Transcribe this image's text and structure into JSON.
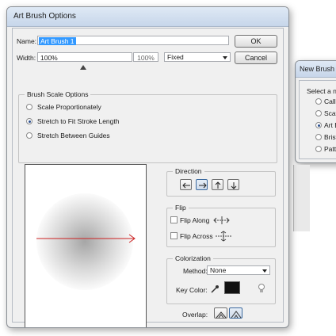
{
  "background_window": {
    "title": "New Brush",
    "prompt": "Select a ne",
    "options": [
      "Callig",
      "Scatt",
      "Art Br",
      "Bristle",
      "Patte"
    ],
    "selected_index": 2
  },
  "dialog": {
    "title": "Art Brush Options",
    "name_label": "Name:",
    "name_value": "Art Brush 1",
    "ok_label": "OK",
    "cancel_label": "Cancel",
    "width_label": "Width:",
    "width_value": "100%",
    "width_readout": "100%",
    "width_mode": "Fixed",
    "scale_options": {
      "legend": "Brush Scale Options",
      "options": [
        "Scale Proportionately",
        "Stretch to Fit Stroke Length",
        "Stretch Between Guides"
      ],
      "selected_index": 1
    },
    "direction": {
      "legend": "Direction",
      "selected": "right"
    },
    "flip": {
      "legend": "Flip",
      "along_label": "Flip Along",
      "across_label": "Flip Across",
      "along_checked": false,
      "across_checked": false
    },
    "colorization": {
      "legend": "Colorization",
      "method_label": "Method:",
      "method_value": "None",
      "key_color_label": "Key Color:",
      "key_color": "#111111"
    },
    "overlap_label": "Overlap:",
    "preview_stroke_color": "#cc2222"
  }
}
